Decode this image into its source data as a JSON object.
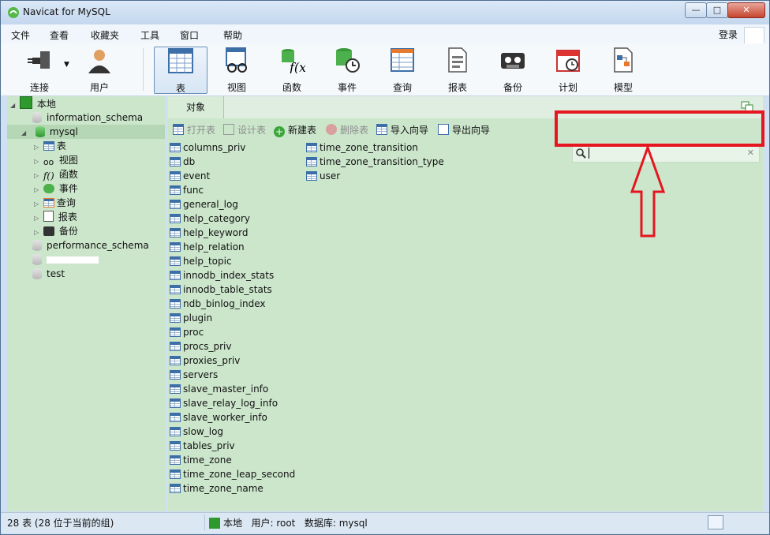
{
  "window": {
    "title": "Navicat for MySQL",
    "buttons": {
      "minimize": "—",
      "maximize": "□",
      "close": "✕"
    }
  },
  "menu": {
    "items": [
      "文件",
      "查看",
      "收藏夹",
      "工具",
      "窗口",
      "帮助"
    ],
    "login": "登录"
  },
  "toolbar": {
    "items": [
      {
        "label": "连接",
        "icon": "plug-icon"
      },
      {
        "label": "用户",
        "icon": "user-icon"
      },
      {
        "label": "表",
        "icon": "table-icon",
        "active": true
      },
      {
        "label": "视图",
        "icon": "view-glasses-icon"
      },
      {
        "label": "函数",
        "icon": "function-icon"
      },
      {
        "label": "事件",
        "icon": "event-clock-icon"
      },
      {
        "label": "查询",
        "icon": "query-icon"
      },
      {
        "label": "报表",
        "icon": "report-icon"
      },
      {
        "label": "备份",
        "icon": "backup-tape-icon"
      },
      {
        "label": "计划",
        "icon": "schedule-calendar-icon"
      },
      {
        "label": "模型",
        "icon": "model-icon"
      }
    ]
  },
  "tree": {
    "root": "本地",
    "databases": {
      "information_schema": "information_schema",
      "mysql": "mysql",
      "performance_schema": "performance_schema",
      "test": "test"
    },
    "mysql_children": [
      "表",
      "视图",
      "函数",
      "事件",
      "查询",
      "报表",
      "备份"
    ],
    "function_prefix": "f()"
  },
  "main": {
    "tab": "对象",
    "actions": [
      "打开表",
      "设计表",
      "新建表",
      "删除表",
      "导入向导",
      "导出向导"
    ],
    "search": {
      "value": "",
      "clear": "✕"
    },
    "tables_col1": [
      "columns_priv",
      "db",
      "event",
      "func",
      "general_log",
      "help_category",
      "help_keyword",
      "help_relation",
      "help_topic",
      "innodb_index_stats",
      "innodb_table_stats",
      "ndb_binlog_index",
      "plugin",
      "proc",
      "procs_priv",
      "proxies_priv",
      "servers",
      "slave_master_info",
      "slave_relay_log_info",
      "slave_worker_info",
      "slow_log",
      "tables_priv",
      "time_zone",
      "time_zone_leap_second",
      "time_zone_name"
    ],
    "tables_col2": [
      "time_zone_transition",
      "time_zone_transition_type",
      "user"
    ]
  },
  "status": {
    "left": "28 表 (28 位于当前的组)",
    "connection": "本地",
    "user": "用户: root",
    "database": "数据库: mysql"
  },
  "colors": {
    "tree_bg": "#cce6cc",
    "highlight": "#e5161f",
    "table_icon": "#3c6ea8"
  }
}
